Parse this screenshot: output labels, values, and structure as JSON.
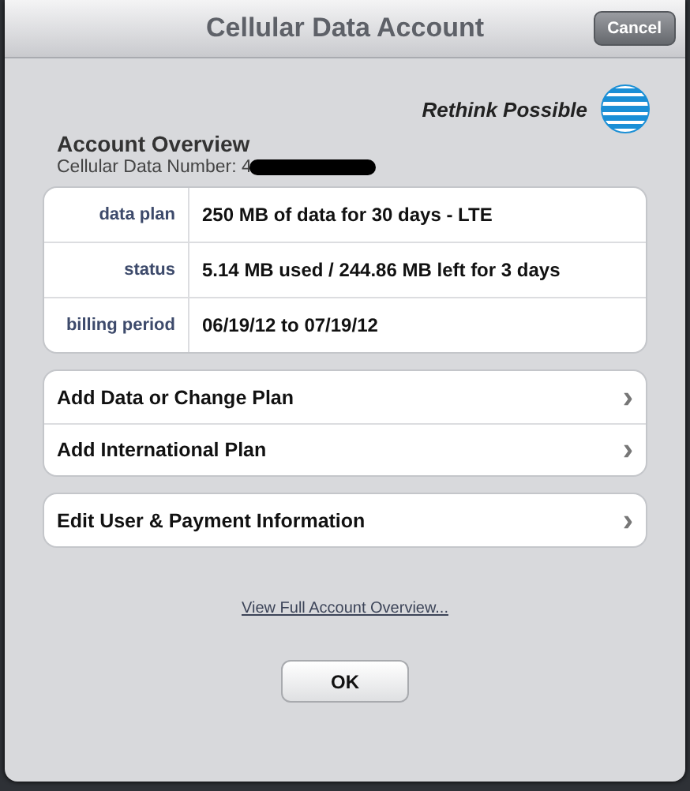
{
  "window": {
    "title": "Cellular Data Account",
    "cancel_button": "Cancel"
  },
  "brand": {
    "tagline": "Rethink Possible"
  },
  "overview": {
    "heading": "Account Overview",
    "number_label": "Cellular Data Number: 4"
  },
  "details": [
    {
      "label": "data plan",
      "value": "250 MB of data for 30 days - LTE"
    },
    {
      "label": "status",
      "value": "5.14 MB used / 244.86 MB left for 3 days"
    },
    {
      "label": "billing period",
      "value": "06/19/12 to 07/19/12"
    }
  ],
  "action_groups": [
    [
      {
        "label": "Add Data or Change Plan",
        "chevron": "›"
      },
      {
        "label": "Add International Plan",
        "chevron": "›"
      }
    ],
    [
      {
        "label": "Edit User & Payment Information",
        "chevron": "›"
      }
    ]
  ],
  "link": "View Full Account Overview...",
  "ok_button": "OK"
}
